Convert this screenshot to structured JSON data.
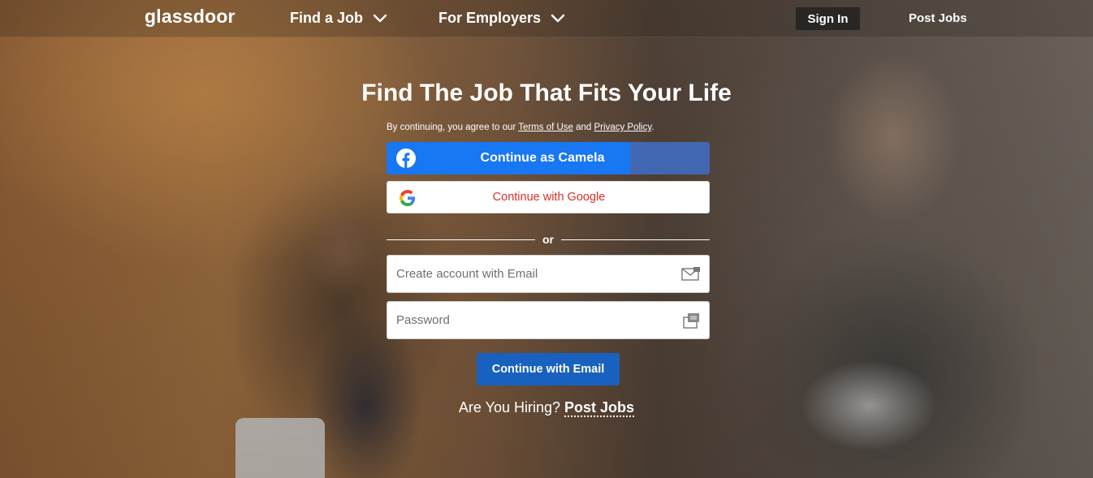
{
  "header": {
    "logo": "glassdoor",
    "nav": [
      {
        "label": "Find a Job"
      },
      {
        "label": "For Employers"
      }
    ],
    "sign_in": "Sign In",
    "post_jobs": "Post Jobs"
  },
  "main": {
    "headline": "Find The Job That Fits Your Life",
    "terms_prefix": "By continuing, you agree to our ",
    "terms_link": "Terms of Use",
    "terms_and": " and ",
    "privacy_link": "Privacy Policy",
    "terms_suffix": ".",
    "facebook_button": "Continue as Camela",
    "google_button": "Continue with Google",
    "divider": "or",
    "email_placeholder": "Create account with Email",
    "password_placeholder": "Password",
    "email_button": "Continue with Email",
    "hiring_prompt": "Are You Hiring?",
    "hiring_link": "Post Jobs"
  },
  "icons": {
    "facebook": "facebook-icon",
    "google": "google-icon",
    "email": "envelope-icon",
    "password": "key-icon",
    "chevron": "chevron-down-icon"
  },
  "colors": {
    "facebook_blue": "#1877f2",
    "facebook_dark": "#4267b2",
    "google_red": "#d93025",
    "email_button": "#1861bf"
  }
}
